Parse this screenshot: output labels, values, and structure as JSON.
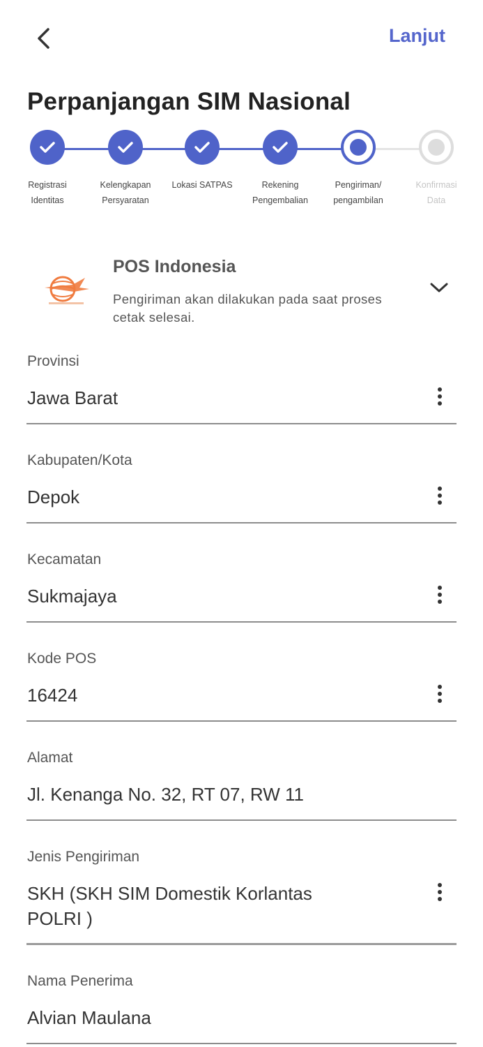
{
  "header": {
    "back_icon": "chevron-left-icon",
    "next_label": "Lanjut",
    "title": "Perpanjangan SIM Nasional"
  },
  "colors": {
    "primary": "#4f63c9",
    "pending": "#dddddd",
    "logo_orange": "#f07b3f"
  },
  "stepper": {
    "steps": [
      {
        "line1": "Registrasi",
        "line2": "Identitas",
        "status": "done"
      },
      {
        "line1": "Kelengkapan",
        "line2": "Persyaratan",
        "status": "done"
      },
      {
        "line1": "Lokasi SATPAS",
        "line2": "",
        "status": "done"
      },
      {
        "line1": "Rekening",
        "line2": "Pengembalian",
        "status": "done"
      },
      {
        "line1": "Pengiriman/",
        "line2": "pengambilan",
        "status": "current"
      },
      {
        "line1": "Konfirmasi",
        "line2": "Data",
        "status": "pending"
      }
    ]
  },
  "courier": {
    "logo_text": "POS INDONESIA",
    "name": "POS Indonesia",
    "description": "Pengiriman akan dilakukan pada saat proses cetak selesai."
  },
  "form": {
    "fields": [
      {
        "label": "Provinsi",
        "value": "Jawa Barat",
        "has_menu": true
      },
      {
        "label": "Kabupaten/Kota",
        "value": "Depok",
        "has_menu": true
      },
      {
        "label": "Kecamatan",
        "value": "Sukmajaya",
        "has_menu": true
      },
      {
        "label": "Kode POS",
        "value": "16424",
        "has_menu": true
      },
      {
        "label": "Alamat",
        "value": "Jl. Kenanga No. 32, RT 07, RW 11",
        "has_menu": false
      },
      {
        "label": "Jenis Pengiriman",
        "value_line1": "SKH (SKH SIM Domestik Korlantas",
        "value_line2": "POLRI )",
        "has_menu": true
      },
      {
        "label": "Nama Penerima",
        "value": "Alvian Maulana",
        "has_menu": false
      }
    ]
  }
}
